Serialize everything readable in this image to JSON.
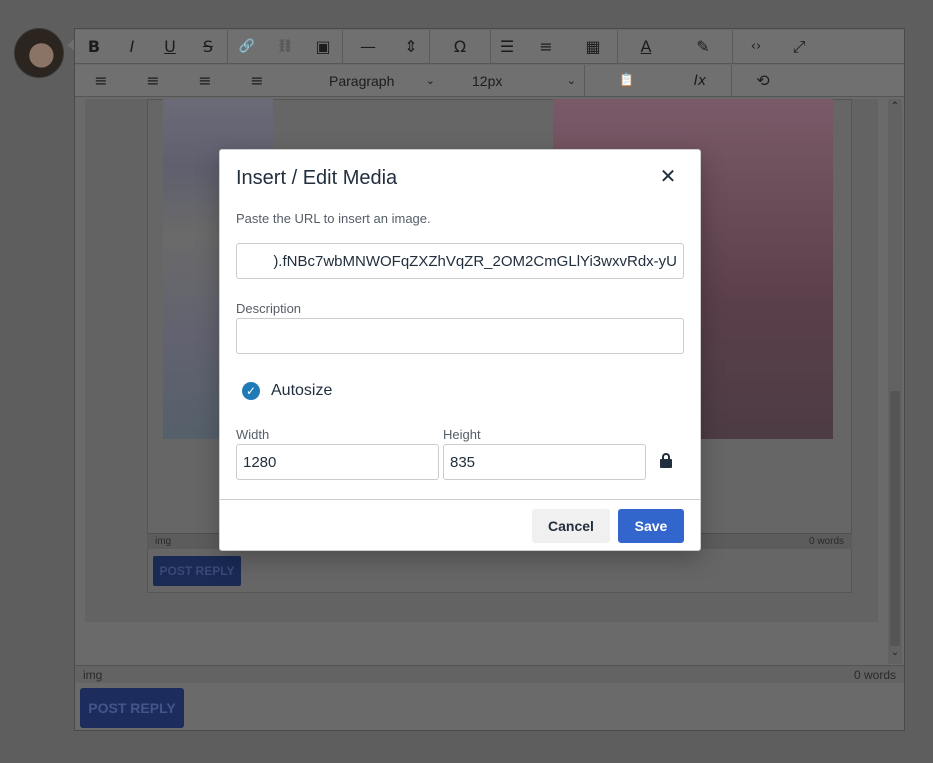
{
  "background": {
    "toolbar": {
      "row1": [
        {
          "name": "bold-icon",
          "glyph": "B"
        },
        {
          "name": "italic-icon",
          "glyph": "I"
        },
        {
          "name": "underline-icon",
          "glyph": "U"
        },
        {
          "name": "strikethrough-icon",
          "glyph": "S"
        },
        {
          "name": "link-icon",
          "glyph": "🔗"
        },
        {
          "name": "unlink-icon",
          "glyph": "⛓"
        },
        {
          "name": "image-icon",
          "glyph": "▣"
        },
        {
          "name": "horizontal-rule-icon",
          "glyph": "—"
        },
        {
          "name": "page-break-icon",
          "glyph": "⇕"
        },
        {
          "name": "special-char-icon",
          "glyph": "Ω"
        },
        {
          "name": "bullet-list-icon",
          "glyph": "☰"
        },
        {
          "name": "numbered-list-icon",
          "glyph": "≡"
        },
        {
          "name": "table-icon",
          "glyph": "▦"
        },
        {
          "name": "text-color-icon",
          "glyph": "A"
        },
        {
          "name": "highlight-icon",
          "glyph": "✎"
        },
        {
          "name": "source-code-icon",
          "glyph": "‹›"
        },
        {
          "name": "fullscreen-icon",
          "glyph": "⤢"
        }
      ],
      "row2_align": [
        {
          "name": "align-left-icon",
          "glyph": "≡"
        },
        {
          "name": "align-center-icon",
          "glyph": "≡"
        },
        {
          "name": "align-right-icon",
          "glyph": "≡"
        },
        {
          "name": "align-justify-icon",
          "glyph": "≡"
        }
      ],
      "block_format": "Paragraph",
      "font_size": "12px",
      "paste-icon": "📋",
      "clear-format-icon": "Ix",
      "history-icon": "⟲"
    },
    "inner_status_path": "img",
    "inner_word_count": "0 words",
    "inner_post_reply": "POST REPLY",
    "status_path": "img",
    "word_count": "0 words",
    "post_reply": "POST REPLY"
  },
  "dialog": {
    "title": "Insert / Edit Media",
    "close_glyph": "✕",
    "hint": "Paste the URL to insert an image.",
    "url_value": ").fNBc7wbMNWOFqZXZhVqZR_2OM2CmGLlYi3wxvRdx-yU",
    "description_label": "Description",
    "description_value": "",
    "autosize_label": "Autosize",
    "autosize_checked": true,
    "check_glyph": "✓",
    "width_label": "Width",
    "width_value": "1280",
    "height_label": "Height",
    "height_value": "835",
    "cancel_label": "Cancel",
    "save_label": "Save"
  }
}
